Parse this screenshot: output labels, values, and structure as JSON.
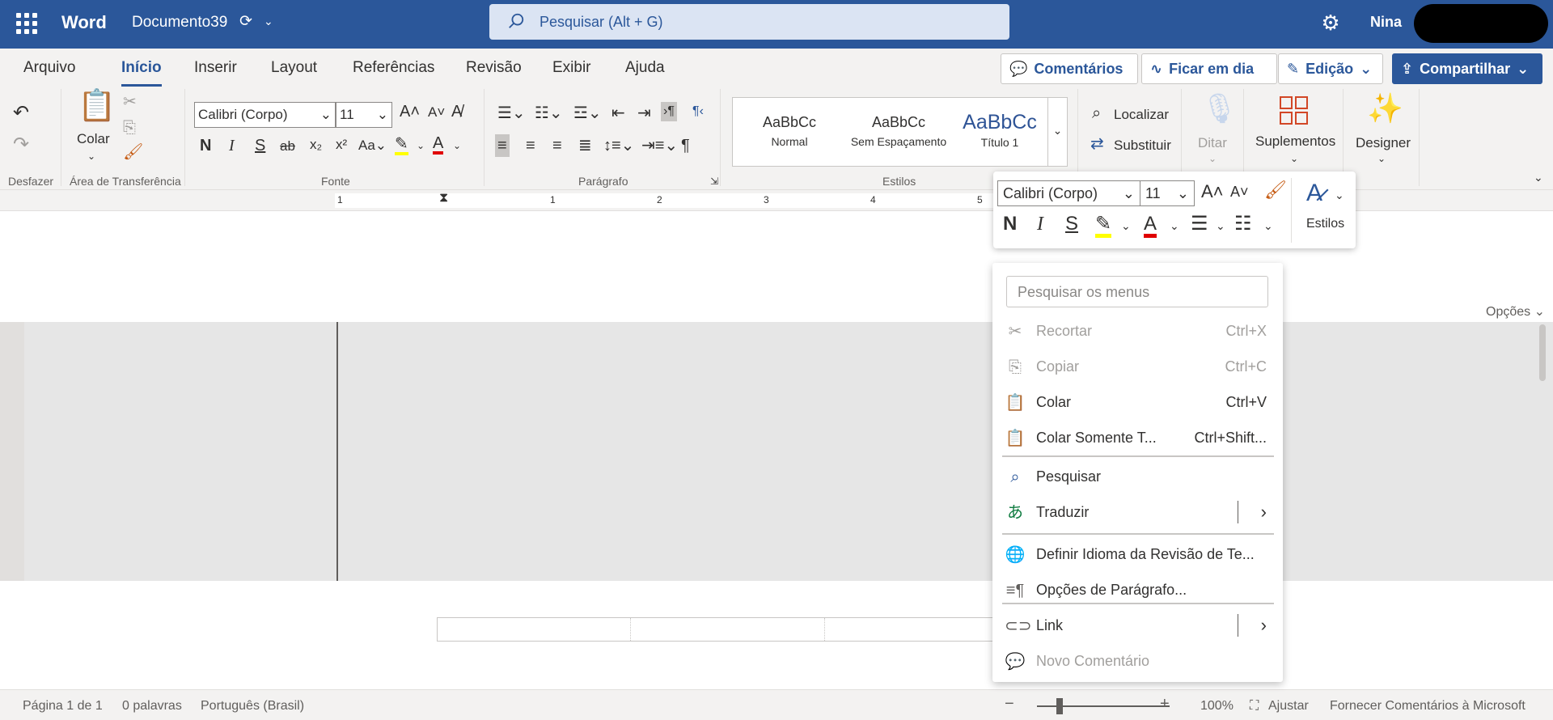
{
  "titlebar": {
    "app_name": "Word",
    "doc_name": "Documento39",
    "search_placeholder": "Pesquisar (Alt + G)",
    "user_name": "Nina"
  },
  "tabs": [
    "Arquivo",
    "Início",
    "Inserir",
    "Layout",
    "Referências",
    "Revisão",
    "Exibir",
    "Ajuda"
  ],
  "active_tab": "Início",
  "top_buttons": {
    "comments": "Comentários",
    "catch_up": "Ficar em dia",
    "editing": "Edição",
    "share": "Compartilhar"
  },
  "ribbon": {
    "groups": {
      "undo": "Desfazer",
      "clipboard": "Área de Transferência",
      "font": "Fonte",
      "paragraph": "Parágrafo",
      "styles": "Estilos"
    },
    "paste_label": "Colar",
    "font_name": "Calibri (Corpo)",
    "font_size": "11",
    "styles": [
      {
        "sample": "AaBbCc",
        "name": "Normal",
        "color": "#323130"
      },
      {
        "sample": "AaBbCc",
        "name": "Sem Espaçamento",
        "color": "#323130"
      },
      {
        "sample": "AaBbCc",
        "name": "Título 1",
        "color": "#2f5496"
      }
    ],
    "find_label": "Localizar",
    "replace_label": "Substituir",
    "dictate_label": "Ditar",
    "addins_label": "Suplementos",
    "designer_label": "Designer"
  },
  "ruler": {
    "numbers": [
      "1",
      "1",
      "2",
      "3",
      "4",
      "5"
    ]
  },
  "options_label": "Opções",
  "mini_toolbar": {
    "font_name": "Calibri (Corpo)",
    "font_size": "11",
    "styles_label": "Estilos"
  },
  "context_menu": {
    "search_placeholder": "Pesquisar os menus",
    "items": [
      {
        "label": "Recortar",
        "shortcut": "Ctrl+X",
        "icon": "scissors-icon",
        "disabled": true
      },
      {
        "label": "Copiar",
        "shortcut": "Ctrl+C",
        "icon": "copy-icon",
        "disabled": true
      },
      {
        "label": "Colar",
        "shortcut": "Ctrl+V",
        "icon": "paste-icon",
        "disabled": false
      },
      {
        "label": "Colar Somente T...",
        "shortcut": "Ctrl+Shift...",
        "icon": "paste-text-icon",
        "disabled": false
      },
      {
        "label": "Pesquisar",
        "shortcut": "",
        "icon": "search-icon",
        "disabled": false
      },
      {
        "label": "Traduzir",
        "shortcut": "",
        "icon": "translate-icon",
        "disabled": false,
        "submenu": true
      },
      {
        "label": "Definir Idioma da Revisão de Te...",
        "shortcut": "",
        "icon": "language-icon",
        "disabled": false
      },
      {
        "label": "Opções de Parágrafo...",
        "shortcut": "",
        "icon": "paragraph-options-icon",
        "disabled": false
      },
      {
        "label": "Link",
        "shortcut": "",
        "icon": "link-icon",
        "disabled": false,
        "submenu": true
      },
      {
        "label": "Novo Comentário",
        "shortcut": "",
        "icon": "comment-icon",
        "disabled": true
      }
    ]
  },
  "statusbar": {
    "page": "Página 1 de 1",
    "words": "0 palavras",
    "language": "Português (Brasil)",
    "zoom_out": "−",
    "zoom_in": "+",
    "zoom": "100%",
    "fit": "Ajustar",
    "feedback": "Fornecer Comentários à Microsoft"
  },
  "colors": {
    "brand": "#2b579a",
    "highlight": "#ffff00",
    "font_color": "#e00000"
  }
}
